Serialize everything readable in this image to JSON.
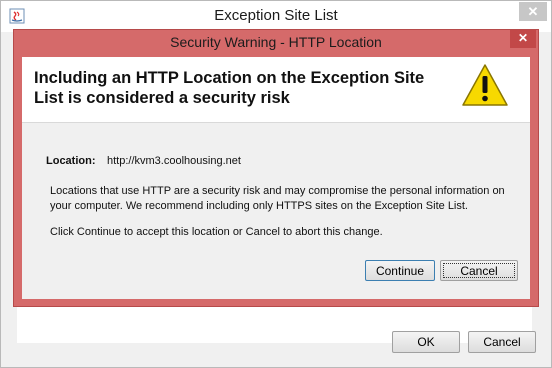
{
  "parent_window": {
    "title": "Exception Site List",
    "close_glyph": "✕",
    "ok_label": "OK",
    "cancel_label": "Cancel",
    "icon": "java-app-icon"
  },
  "dialog": {
    "title": "Security Warning - HTTP Location",
    "close_glyph": "✕",
    "heading": "Including an HTTP Location on the Exception Site List is considered a security risk",
    "warning_icon": "warning-icon",
    "location_label": "Location:",
    "location_value": "http://kvm3.coolhousing.net",
    "description": "Locations that use HTTP are a security risk and may compromise the personal information on your computer.  We recommend including only HTTPS sites on the Exception Site List.",
    "instruction": "Click Continue to accept this location or Cancel to abort this change.",
    "continue_label": "Continue",
    "cancel_label": "Cancel"
  },
  "colors": {
    "dialog_frame": "#d56a6a",
    "dialog_close": "#c24848",
    "warning_fill": "#f7d900",
    "default_button_border": "#3c7fb1"
  }
}
